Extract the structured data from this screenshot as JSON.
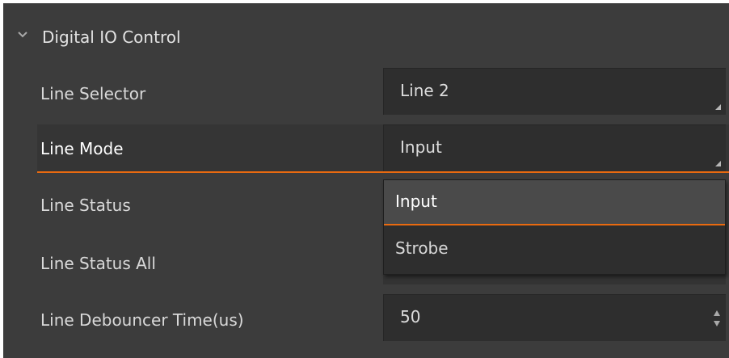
{
  "section": {
    "title": "Digital IO Control",
    "icon": "chevron-down-icon"
  },
  "rows": [
    {
      "label": "Line Selector",
      "value": "Line 2"
    },
    {
      "label": "Line Mode",
      "value": "Input"
    },
    {
      "label": "Line Status"
    },
    {
      "label": "Line Status All"
    },
    {
      "label": "Line Debouncer Time(us)",
      "value": "50"
    }
  ],
  "dropdown": {
    "options": [
      "Input",
      "Strobe"
    ],
    "selected": "Input"
  },
  "colors": {
    "panel_bg": "#3c3c3c",
    "field_bg": "#2e2e2e",
    "accent": "#e96a10",
    "text": "#d9d9d9"
  }
}
